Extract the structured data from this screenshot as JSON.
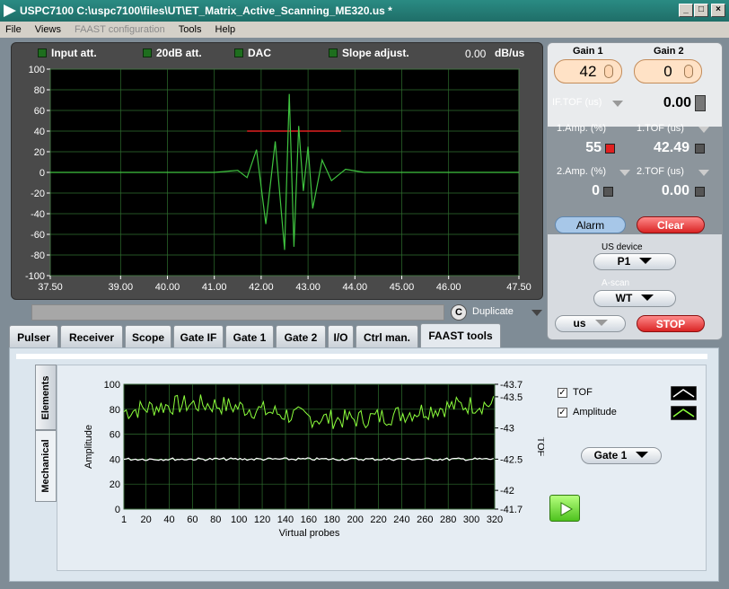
{
  "window": {
    "title": "USPC7100 C:\\uspc7100\\files\\UT\\ET_Matrix_Active_Scanning_ME320.us *"
  },
  "menu": [
    {
      "label": "File",
      "enabled": true
    },
    {
      "label": "Views",
      "enabled": true
    },
    {
      "label": "FAAST configuration",
      "enabled": false
    },
    {
      "label": "Tools",
      "enabled": true
    },
    {
      "label": "Help",
      "enabled": true
    }
  ],
  "scope": {
    "indicators": [
      "Input att.",
      "20dB att.",
      "DAC",
      "Slope adjust."
    ],
    "slope_value": "0.00",
    "slope_unit": "dB/us",
    "y_ticks": [
      "100",
      "80",
      "60",
      "40",
      "20",
      "0",
      "-20",
      "-40",
      "-60",
      "-80",
      "-100"
    ],
    "x_ticks": [
      "37.50",
      "39.00",
      "40.00",
      "41.00",
      "42.00",
      "43.00",
      "44.00",
      "45.00",
      "46.00",
      "47.50"
    ],
    "chart_data": {
      "type": "line",
      "x_range": [
        37.5,
        47.5
      ],
      "ylim": [
        -100,
        100
      ],
      "grid": true,
      "trace_color": "#3fc33f",
      "gate_color": "#e02020",
      "gate": {
        "start": 41.7,
        "end": 43.7,
        "level": 40
      },
      "series": [
        {
          "x": [
            37.5,
            41.0,
            41.5,
            41.7,
            41.9,
            42.1,
            42.3,
            42.5,
            42.6,
            42.7,
            42.8,
            42.9,
            43.0,
            43.1,
            43.3,
            43.5,
            43.8,
            44.2,
            47.5
          ],
          "y": [
            0,
            0,
            2,
            -5,
            22,
            -50,
            30,
            -75,
            76,
            -72,
            45,
            -18,
            25,
            -35,
            12,
            -8,
            3,
            0,
            0
          ]
        }
      ]
    }
  },
  "duplicate": {
    "label": "Duplicate",
    "icon": "c-circle-icon"
  },
  "right": {
    "gain1_label": "Gain 1",
    "gain1_value": "42",
    "gain2_label": "Gain 2",
    "gain2_value": "0",
    "iftof_label": "IF.TOF (us)",
    "iftof_value": "0.00",
    "amp1_label": "1.Amp. (%)",
    "amp1_value": "55",
    "tof1_label": "1.TOF (us)",
    "tof1_value": "42.49",
    "amp2_label": "2.Amp. (%)",
    "amp2_value": "0",
    "tof2_label": "2.TOF (us)",
    "tof2_value": "0.00",
    "alarm_label": "Alarm",
    "clear_label": "Clear",
    "usdevice_label": "US device",
    "usdevice_value": "P1",
    "ascan_label": "A-scan",
    "ascan_value": "WT",
    "unit_value": "us",
    "stop_label": "STOP"
  },
  "tabs": [
    "Pulser",
    "Receiver",
    "Scope",
    "Gate IF",
    "Gate 1",
    "Gate 2",
    "I/O",
    "Ctrl man.",
    "FAAST tools"
  ],
  "active_tab": "FAAST tools",
  "side_tabs": [
    "Elements",
    "Mechanical"
  ],
  "probe_chart": {
    "left_ticks": [
      "100",
      "80",
      "60",
      "40",
      "20",
      "0"
    ],
    "right_ticks": [
      "-43.7",
      "-43.5",
      "-43",
      "-42.5",
      "-42",
      "-41.7"
    ],
    "x_ticks": [
      "1",
      "20",
      "40",
      "60",
      "80",
      "100",
      "120",
      "140",
      "160",
      "180",
      "200",
      "220",
      "240",
      "260",
      "280",
      "300",
      "320"
    ],
    "ylabel": "Amplitude",
    "y2label": "TOF",
    "xlabel": "Virtual probes",
    "chart_data": {
      "type": "line",
      "x_range": [
        1,
        320
      ],
      "ylim": [
        0,
        100
      ],
      "y2lim": [
        -41.7,
        -43.7
      ],
      "grid": true,
      "series": [
        {
          "name": "TOF",
          "color": "#ffffff",
          "approx": "flat near -42.5",
          "mean": -42.5
        },
        {
          "name": "Amplitude",
          "color": "#8cff3c",
          "approx": "noisy 65-90",
          "mean": 78
        }
      ]
    },
    "legend": [
      {
        "label": "TOF",
        "checked": true
      },
      {
        "label": "Amplitude",
        "checked": true
      }
    ],
    "gate_select": "Gate 1"
  }
}
